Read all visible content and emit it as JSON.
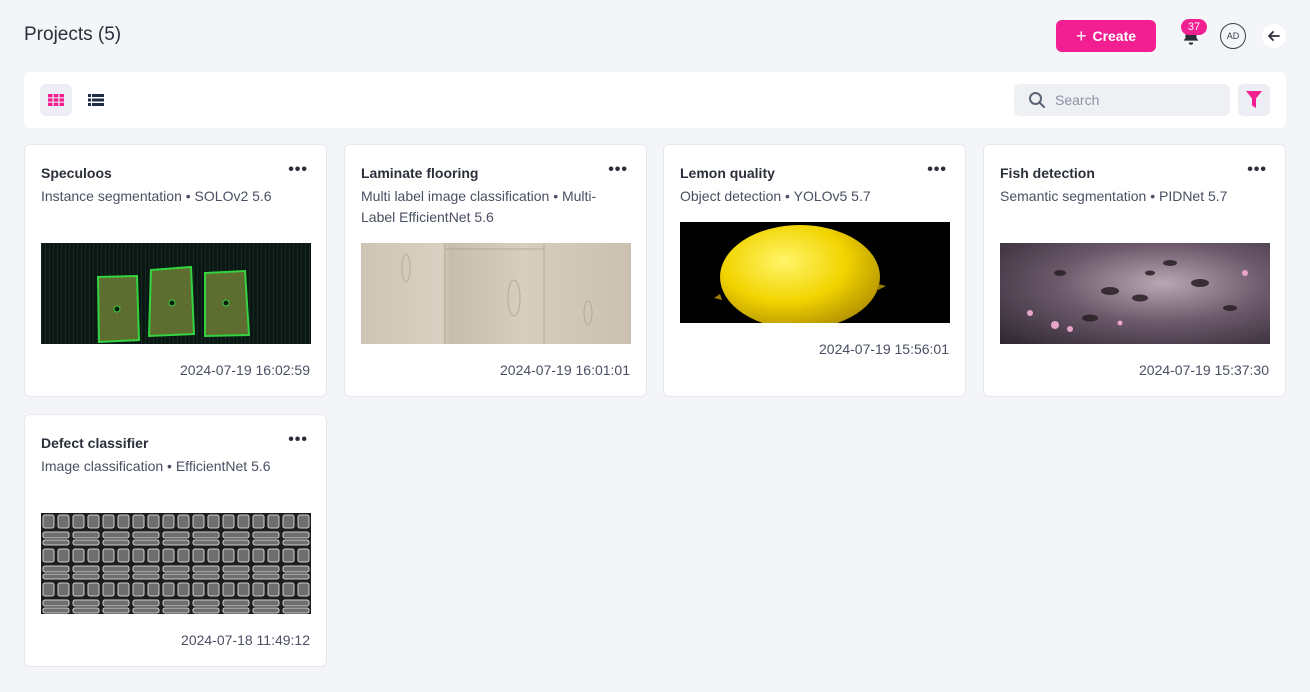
{
  "header": {
    "title": "Projects (5)",
    "create_label": "Create",
    "notification_count": "37",
    "avatar_initials": "AD"
  },
  "toolbar": {
    "search_placeholder": "Search",
    "active_view": "grid"
  },
  "colors": {
    "accent": "#f21f93"
  },
  "projects": [
    {
      "name": "Speculoos",
      "description": "Instance segmentation • SOLOv2 5.6",
      "date": "2024-07-19 16:02:59"
    },
    {
      "name": "Laminate flooring",
      "description": "Multi label image classification • Multi-Label EfficientNet 5.6",
      "date": "2024-07-19 16:01:01"
    },
    {
      "name": "Lemon quality",
      "description": "Object detection • YOLOv5 5.7",
      "date": "2024-07-19 15:56:01"
    },
    {
      "name": "Fish detection",
      "description": "Semantic segmentation • PIDNet 5.7",
      "date": "2024-07-19 15:37:30"
    },
    {
      "name": "Defect classifier",
      "description": "Image classification • EfficientNet 5.6",
      "date": "2024-07-18 11:49:12"
    }
  ]
}
